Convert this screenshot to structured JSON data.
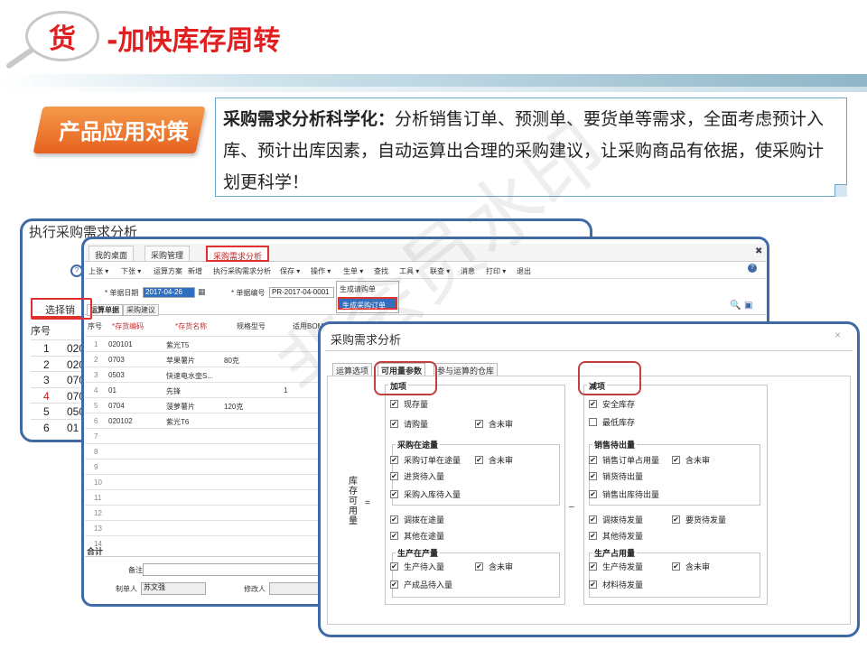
{
  "header": {
    "icon_char": "货",
    "title": "-加快库存周转"
  },
  "tag": {
    "label": "产品应用对策"
  },
  "description": {
    "bold": "采购需求分析科学化：",
    "text": "分析销售订单、预测单、要货单等需求，全面考虑预计入库、预计出库因素，自动运算出合理的采购建议，让采购商品有依据，使采购计划更科学！"
  },
  "back_panel": {
    "title": "执行采购需求分析",
    "select_label": "选择销",
    "col_header": "序号",
    "rows": [
      {
        "no": "1",
        "code": "020"
      },
      {
        "no": "2",
        "code": "020"
      },
      {
        "no": "3",
        "code": "070"
      },
      {
        "no": "4",
        "code": "070"
      },
      {
        "no": "5",
        "code": "050"
      },
      {
        "no": "6",
        "code": "01"
      }
    ]
  },
  "main_window": {
    "tabs": [
      "我的桌面",
      "采购管理",
      "采购需求分析"
    ],
    "toolbar": [
      "上张 ▾",
      "下张 ▾",
      "运算方案",
      "新增",
      "执行采购需求分析",
      "保存 ▾",
      "操作 ▾",
      "生单 ▾",
      "查找",
      "工具 ▾",
      "联查 ▾",
      "消息",
      "打印 ▾",
      "退出"
    ],
    "form": {
      "date_label": "* 单据日期",
      "date_value": "2017-04-26",
      "no_label": "* 单据编号",
      "no_value": "PR-2017-04-0001"
    },
    "dropdown": [
      "生成请购单",
      "生成采购订单"
    ],
    "subtabs": [
      "运算单据",
      "采购建议"
    ],
    "grid_headers": [
      "序号",
      "*存货编码",
      "*存货名称",
      "规格型号",
      "适用BOM"
    ],
    "rows": [
      {
        "no": "1",
        "code": "020101",
        "name": "紫光T5",
        "spec": "",
        "bom": ""
      },
      {
        "no": "2",
        "code": "0703",
        "name": "苹果薯片",
        "spec": "80克",
        "bom": ""
      },
      {
        "no": "3",
        "code": "0503",
        "name": "快速电水壶S...",
        "spec": "",
        "bom": ""
      },
      {
        "no": "4",
        "code": "01",
        "name": "先锋",
        "spec": "",
        "bom": "1"
      },
      {
        "no": "5",
        "code": "0704",
        "name": "菠萝薯片",
        "spec": "120克",
        "bom": ""
      },
      {
        "no": "6",
        "code": "020102",
        "name": "紫光T6",
        "spec": "",
        "bom": ""
      },
      {
        "no": "7"
      },
      {
        "no": "8"
      },
      {
        "no": "9"
      },
      {
        "no": "10"
      },
      {
        "no": "11"
      },
      {
        "no": "12"
      },
      {
        "no": "13"
      },
      {
        "no": "14"
      }
    ],
    "total_label": "合计",
    "remark_label": "备注",
    "maker_label": "制单人",
    "maker_value": "苏文强",
    "modifier_label": "修改人"
  },
  "dialog": {
    "title": "采购需求分析",
    "close": "×",
    "tabs": [
      "运算选项",
      "可用量参数",
      "参与运算的仓库"
    ],
    "add_title": "加项",
    "sub_title": "减项",
    "vertical_label": "库存可用量",
    "eq": "=",
    "minus": "–",
    "add": {
      "items1": [
        {
          "label": "现存量",
          "checked": true
        },
        {
          "label": "请购量",
          "checked": true
        },
        {
          "label": "含未审",
          "checked": true
        }
      ],
      "transit_title": "采购在途量",
      "transit": [
        {
          "label": "采购订单在途量",
          "checked": true
        },
        {
          "label": "含未审",
          "checked": true
        },
        {
          "label": "进货待入量",
          "checked": true
        },
        {
          "label": "采购入库待入量",
          "checked": true
        }
      ],
      "items2": [
        {
          "label": "调拨在途量",
          "checked": true
        },
        {
          "label": "其他在途量",
          "checked": true
        }
      ],
      "prod_title": "生产在产量",
      "prod": [
        {
          "label": "生产待入量",
          "checked": true
        },
        {
          "label": "含未审",
          "checked": true
        },
        {
          "label": "产成品待入量",
          "checked": true
        }
      ]
    },
    "sub": {
      "items1": [
        {
          "label": "安全库存",
          "checked": true
        },
        {
          "label": "最低库存",
          "checked": false
        }
      ],
      "sales_title": "销售待出量",
      "sales": [
        {
          "label": "销售订单占用量",
          "checked": true
        },
        {
          "label": "含未审",
          "checked": true
        },
        {
          "label": "销货待出量",
          "checked": true
        },
        {
          "label": "销售出库待出量",
          "checked": true
        }
      ],
      "items2": [
        {
          "label": "调拨待发量",
          "checked": true
        },
        {
          "label": "要货待发量",
          "checked": true
        },
        {
          "label": "其他待发量",
          "checked": true
        }
      ],
      "prod_title": "生产占用量",
      "prod": [
        {
          "label": "生产待发量",
          "checked": true
        },
        {
          "label": "含未审",
          "checked": true
        },
        {
          "label": "材料待发量",
          "checked": true
        }
      ]
    }
  },
  "watermark": "非会员水印"
}
